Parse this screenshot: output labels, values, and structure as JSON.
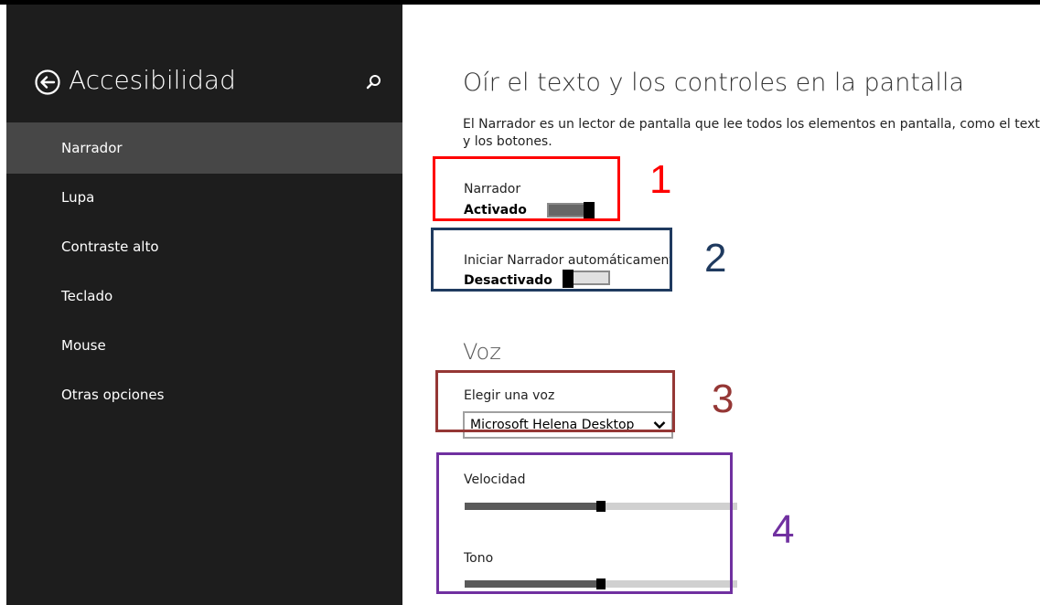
{
  "sidebar": {
    "title": "Accesibilidad",
    "back_icon": "back-arrow-circle-icon",
    "search_icon": "search-icon",
    "items": [
      {
        "label": "Narrador",
        "selected": true
      },
      {
        "label": "Lupa",
        "selected": false
      },
      {
        "label": "Contraste alto",
        "selected": false
      },
      {
        "label": "Teclado",
        "selected": false
      },
      {
        "label": "Mouse",
        "selected": false
      },
      {
        "label": "Otras opciones",
        "selected": false
      }
    ]
  },
  "main": {
    "title": "Oír el texto y los controles en la pantalla",
    "description": "El Narrador es un lector de pantalla que lee todos los elementos en pantalla, como el texto y los botones.",
    "narrator": {
      "label": "Narrador",
      "state": "Activado",
      "on": true
    },
    "autostart": {
      "label": "Iniciar Narrador automáticamente",
      "state": "Desactivado",
      "on": false
    },
    "voice_section": {
      "title": "Voz",
      "choose_label": "Elegir una voz",
      "selected_voice": "Microsoft Helena Desktop"
    },
    "speed": {
      "label": "Velocidad",
      "level": 0.5
    },
    "pitch": {
      "label": "Tono",
      "level": 0.5
    }
  },
  "annotations": [
    {
      "number": "1",
      "color": "#ff0000"
    },
    {
      "number": "2",
      "color": "#1f3a5f"
    },
    {
      "number": "3",
      "color": "#953735"
    },
    {
      "number": "4",
      "color": "#7030a0"
    }
  ]
}
